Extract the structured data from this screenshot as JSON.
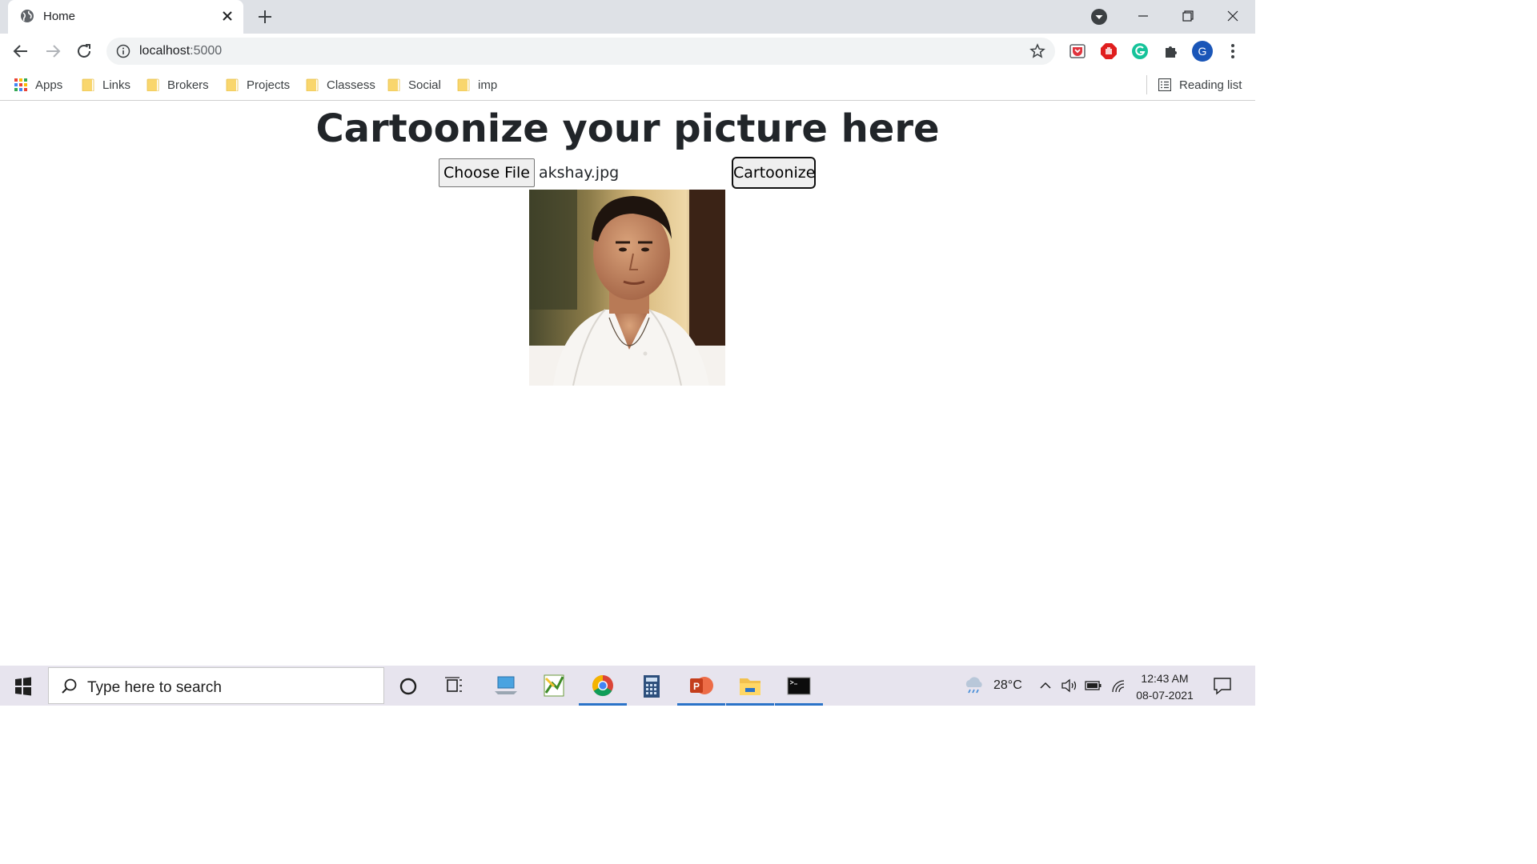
{
  "browser": {
    "tab": {
      "title": "Home"
    },
    "address": {
      "host": "localhost",
      "port": ":5000"
    },
    "bookmarks": [
      {
        "label": "Apps",
        "icon": "apps-grid-icon"
      },
      {
        "label": "Links",
        "icon": "folder-icon"
      },
      {
        "label": "Brokers",
        "icon": "folder-icon"
      },
      {
        "label": "Projects",
        "icon": "folder-icon"
      },
      {
        "label": "Classess",
        "icon": "folder-icon"
      },
      {
        "label": "Social",
        "icon": "folder-icon"
      },
      {
        "label": "imp",
        "icon": "folder-icon"
      }
    ],
    "reading_list": "Reading list",
    "profile_initial": "G"
  },
  "page": {
    "heading": "Cartoonize your picture here",
    "file_button": "Choose File",
    "file_name": "akshay.jpg",
    "submit_button": "Cartoonize"
  },
  "taskbar": {
    "search_placeholder": "Type here to search",
    "temperature": "28°C",
    "time": "12:43 AM",
    "date": "08-07-2021"
  },
  "colors": {
    "tabstrip": "#dee1e6",
    "folder": "#f9d66d",
    "heading": "#212529",
    "accent": "#2b73c8"
  }
}
